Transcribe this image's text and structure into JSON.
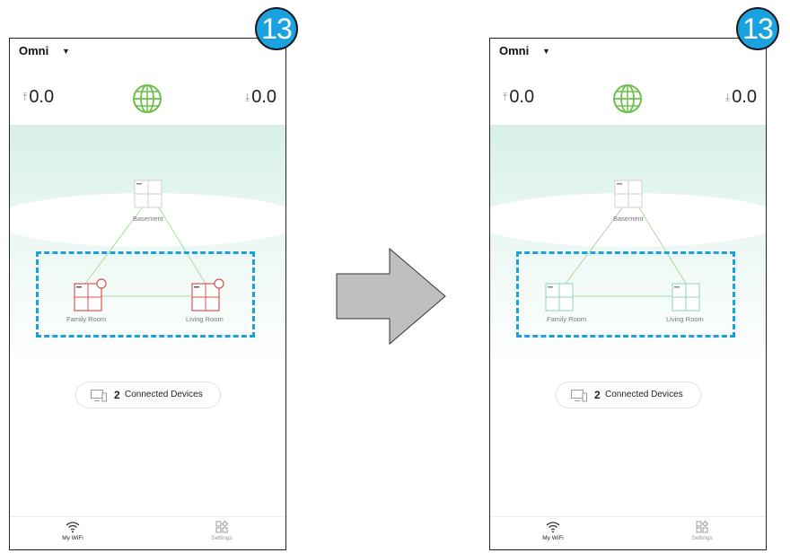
{
  "step_badge": "13",
  "panels": [
    {
      "network_name": "Omni",
      "upload_value": "0.0",
      "download_value": "0.0",
      "nodes": [
        {
          "label": "Basement",
          "state": "online"
        },
        {
          "label": "Family Room",
          "state": "error"
        },
        {
          "label": "Living Room",
          "state": "error"
        }
      ],
      "connected_count": "2",
      "connected_label": "Connected Devices",
      "nav": {
        "wifi_label": "My WiFi",
        "settings_label": "Settings"
      }
    },
    {
      "network_name": "Omni",
      "upload_value": "0.0",
      "download_value": "0.0",
      "nodes": [
        {
          "label": "Basement",
          "state": "online"
        },
        {
          "label": "Family Room",
          "state": "online"
        },
        {
          "label": "Living Room",
          "state": "online"
        }
      ],
      "connected_count": "2",
      "connected_label": "Connected Devices",
      "nav": {
        "wifi_label": "My WiFi",
        "settings_label": "Settings"
      }
    }
  ],
  "colors": {
    "accent_blue": "#1aa2e0",
    "error_red": "#d9534f",
    "link_green": "#a8dca0",
    "online_teal": "#8fd0c6",
    "globe_green": "#6cc04a"
  },
  "icons": {
    "transition": "right-arrow-icon",
    "globe": "globe-icon",
    "wifi": "wifi-icon",
    "settings": "settings-grid-icon",
    "devices": "monitor-icon"
  }
}
